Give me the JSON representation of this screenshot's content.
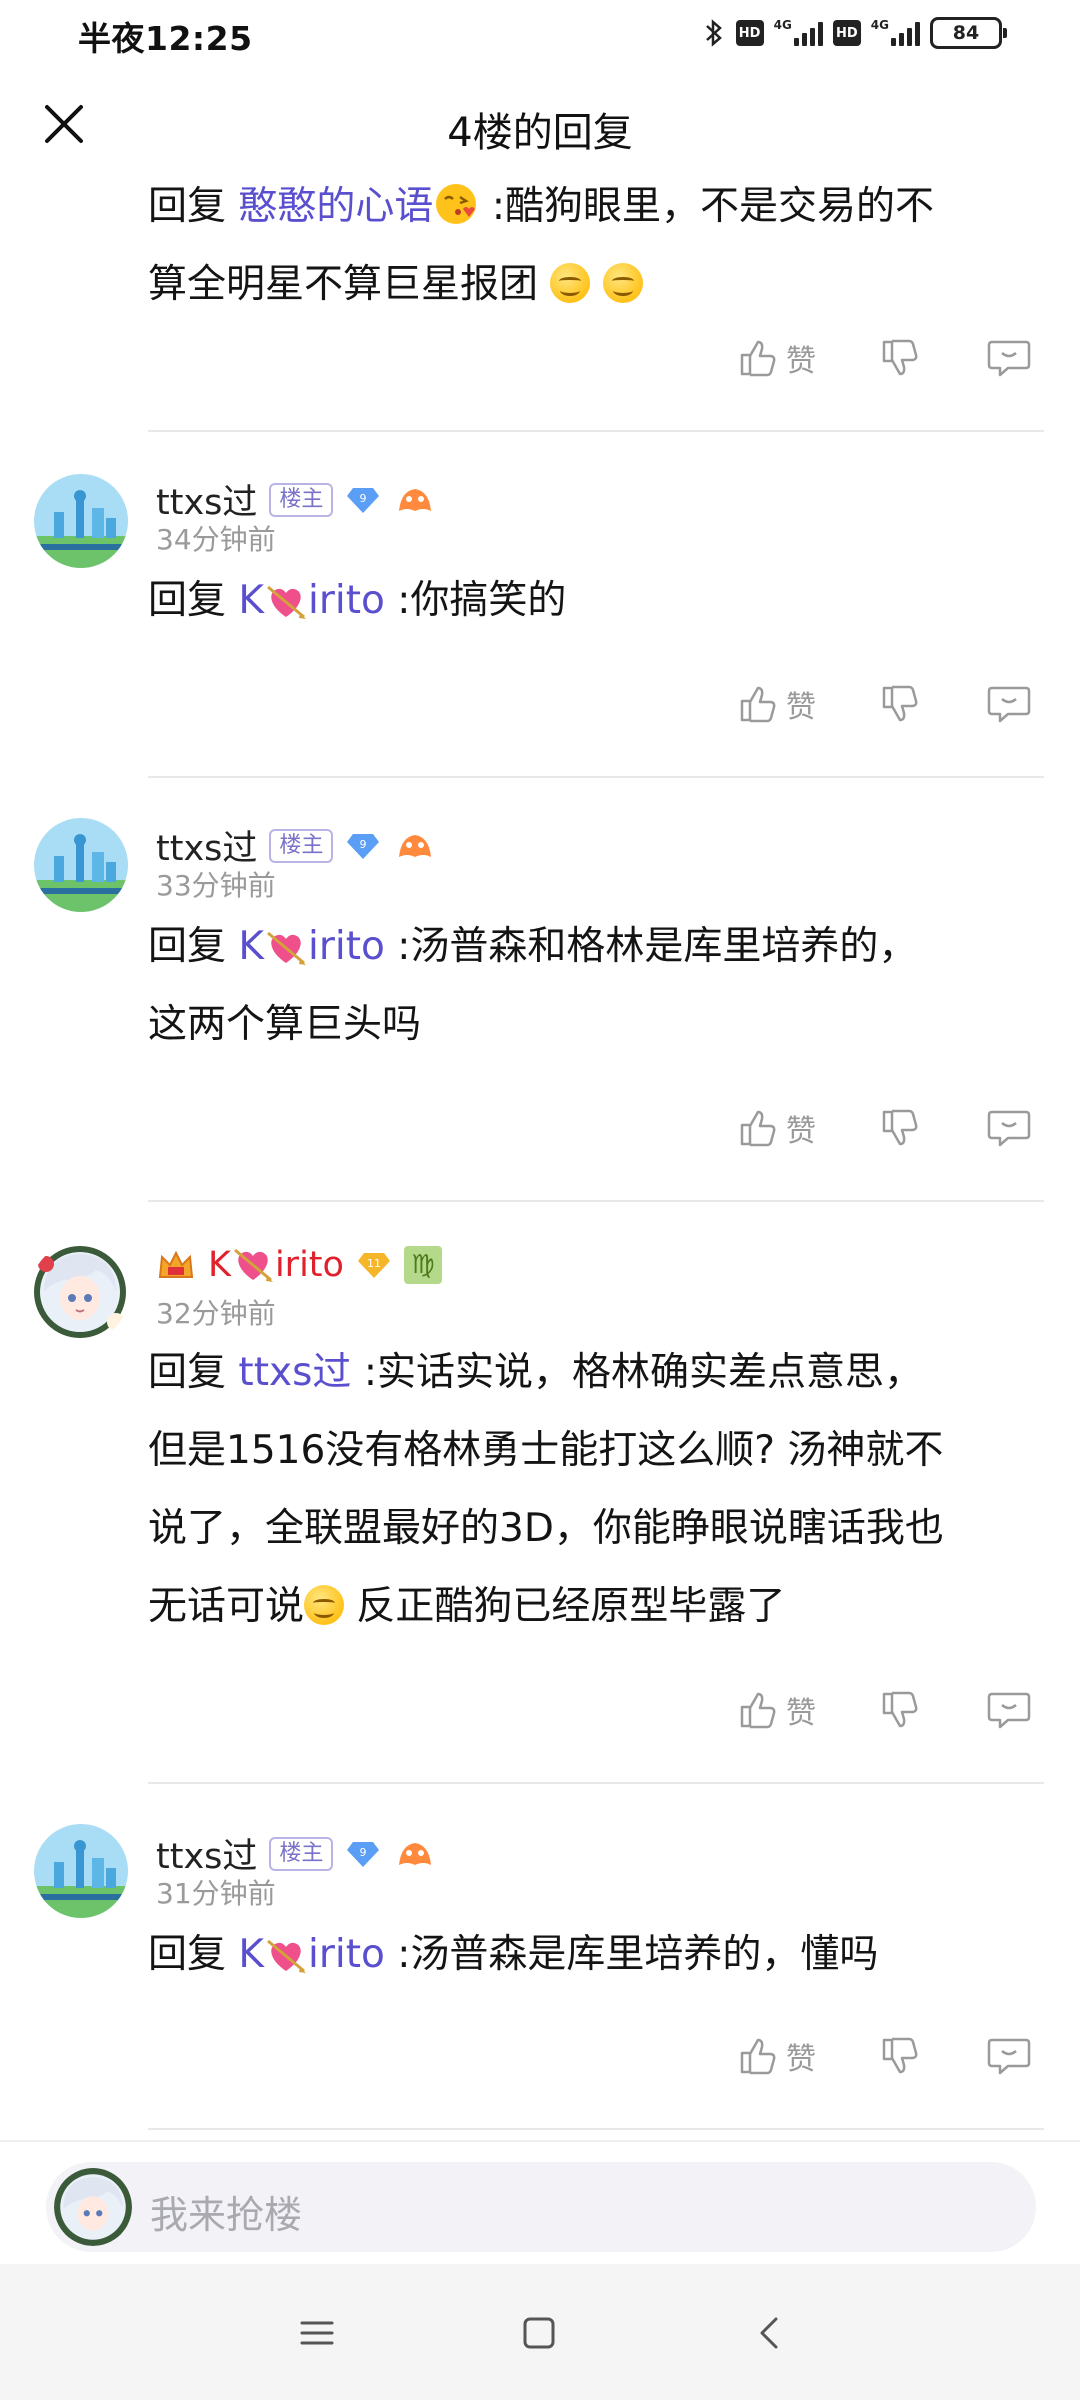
{
  "status_bar": {
    "time": "半夜12:25",
    "hd": "HD",
    "network": "4G",
    "battery": "84"
  },
  "header": {
    "title": "4楼的回复"
  },
  "top_partial_reply": {
    "line1_prefix": "回复",
    "reply_to": "憨憨的心语",
    "line1_text": ":酷狗眼里，不是交易的不",
    "line2_text": "算全明星不算巨星报团"
  },
  "action_labels": {
    "like": "赞"
  },
  "replies": [
    {
      "username": "ttxs过",
      "tag": "楼主",
      "level": "9",
      "time": "34分钟前",
      "prefix": "回复",
      "reply_to_a": "K",
      "reply_to_b": "irito",
      "text": ":你搞笑的"
    },
    {
      "username": "ttxs过",
      "tag": "楼主",
      "level": "9",
      "time": "33分钟前",
      "prefix": "回复",
      "reply_to_a": "K",
      "reply_to_b": "irito",
      "text": ":汤普森和格林是库里培养的，",
      "text2": "这两个算巨头吗"
    },
    {
      "username_a": "K",
      "username_b": "irito",
      "level": "11",
      "zodiac": "♍",
      "time": "32分钟前",
      "prefix": "回复",
      "reply_to": "ttxs过",
      "line1": ":实话实说，格林确实差点意思，",
      "line2": "但是1516没有格林勇士能打这么顺? 汤神就不",
      "line3": "说了，全联盟最好的3D，你能睁眼说瞎话我也",
      "line4a": "无话可说",
      "line4b": "反正酷狗已经原型毕露了"
    },
    {
      "username": "ttxs过",
      "tag": "楼主",
      "level": "9",
      "time": "31分钟前",
      "prefix": "回复",
      "reply_to_a": "K",
      "reply_to_b": "irito",
      "text": ":汤普森是库里培养的，懂吗"
    }
  ],
  "composer": {
    "placeholder": "我来抢楼"
  },
  "colors": {
    "accent": "#5a4fcf",
    "kirito_name": "#e0202a",
    "muted": "#9a9a9a"
  }
}
